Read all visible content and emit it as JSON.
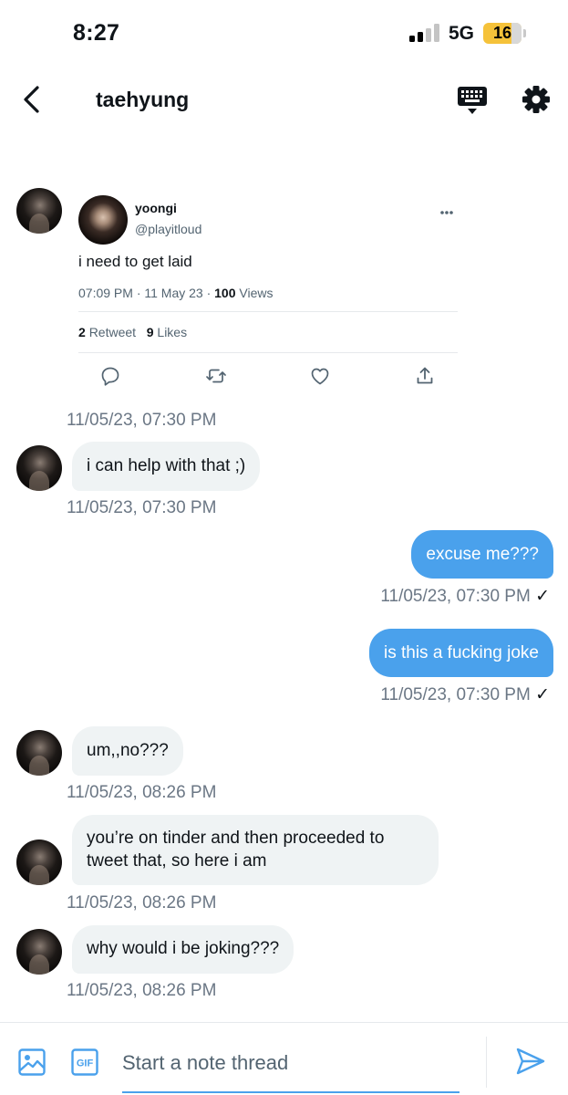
{
  "status_bar": {
    "time": "8:27",
    "network": "5G",
    "battery": "16"
  },
  "header": {
    "title": "taehyung",
    "icons": [
      "chevron-left-icon",
      "keyboard-icon",
      "gear-icon"
    ]
  },
  "tweet": {
    "name": "yoongi",
    "handle": "@playitloud",
    "text": "i need to get laid",
    "time": "07:09 PM · 11 May 23 · ",
    "views_count": "100",
    "views_label": "Views",
    "retweets_count": "2",
    "retweets_label": "Retweet",
    "likes_count": "9",
    "likes_label": "Likes",
    "timestamp": "11/05/23, 07:30 PM"
  },
  "messages": [
    {
      "side": "in",
      "text": "i can help with that ;)",
      "timestamp": "11/05/23, 07:30 PM"
    },
    {
      "side": "out",
      "text": "excuse me???",
      "timestamp": "11/05/23, 07:30 PM",
      "read_mark": "✓"
    },
    {
      "side": "out",
      "text": "is this a fucking joke",
      "timestamp": "11/05/23, 07:30 PM",
      "read_mark": "✓"
    },
    {
      "side": "in",
      "text": "um,,no???",
      "timestamp": "11/05/23, 08:26 PM"
    },
    {
      "side": "in",
      "text": "you’re on tinder and then proceeded to tweet that, so here i am",
      "timestamp": "11/05/23, 08:26 PM"
    },
    {
      "side": "in",
      "text": "why would i be joking???",
      "timestamp": "11/05/23, 08:26 PM"
    }
  ],
  "composer": {
    "placeholder": "Start a note thread",
    "gif_label": "GIF",
    "icons": [
      "image-icon",
      "gif-icon",
      "send-icon"
    ]
  },
  "colors": {
    "accent": "#4aa1ec",
    "incoming_bubble": "#eff3f4",
    "timestamp": "#6b7785",
    "battery": "#f5c23a"
  }
}
